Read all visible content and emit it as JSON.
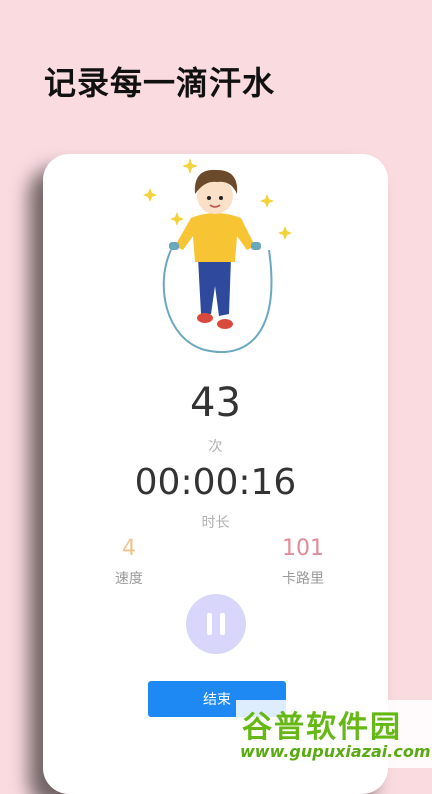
{
  "headline": "记录每一滴汗水",
  "counter": {
    "count_value": "43",
    "count_unit": "次",
    "time_value": "00:00:16",
    "time_unit": "时长"
  },
  "stats": {
    "speed_value": "4",
    "speed_label": "速度",
    "calories_value": "101",
    "calories_label": "卡路里"
  },
  "controls": {
    "pause_icon": "pause-icon",
    "end_label": "结束"
  },
  "watermark": {
    "title": "谷普软件园",
    "url": "www.gupuxiazai.com"
  },
  "colors": {
    "background": "#fadbe0",
    "speed": "#f2c38c",
    "calories": "#e38b96",
    "pause_button": "#d8d7fb",
    "end_button": "#1e88f3"
  }
}
